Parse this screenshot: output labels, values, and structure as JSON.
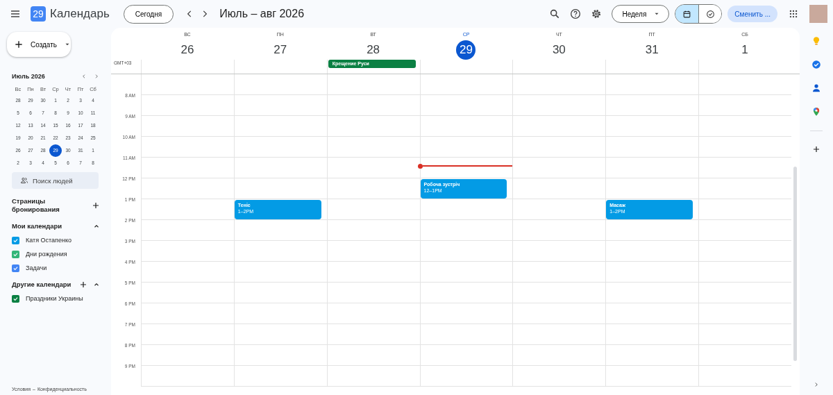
{
  "topbar": {
    "logo_text": "29",
    "app_name": "Календарь",
    "today_button": "Сегодня",
    "date_range": "Июль – авг 2026",
    "view_dropdown": "Неделя",
    "view_toggle": [
      {
        "kind": "calendar",
        "selected": true
      },
      {
        "kind": "tasks",
        "selected": false
      }
    ],
    "switch_button": "Сменить ..."
  },
  "sidebar": {
    "create_button": "Создать",
    "mini_calendar": {
      "title": "Июль 2026",
      "weekdays": [
        "Вс",
        "Пн",
        "Вт",
        "Ср",
        "Чт",
        "Пт",
        "Сб"
      ],
      "weeks": [
        [
          {
            "day": "28",
            "selected": false
          },
          {
            "day": "29",
            "selected": false
          },
          {
            "day": "30",
            "selected": false
          },
          {
            "day": "1",
            "selected": false
          },
          {
            "day": "2",
            "selected": false
          },
          {
            "day": "3",
            "selected": false
          },
          {
            "day": "4",
            "selected": false
          }
        ],
        [
          {
            "day": "5",
            "selected": false
          },
          {
            "day": "6",
            "selected": false
          },
          {
            "day": "7",
            "selected": false
          },
          {
            "day": "8",
            "selected": false
          },
          {
            "day": "9",
            "selected": false
          },
          {
            "day": "10",
            "selected": false
          },
          {
            "day": "11",
            "selected": false
          }
        ],
        [
          {
            "day": "12",
            "selected": false
          },
          {
            "day": "13",
            "selected": false
          },
          {
            "day": "14",
            "selected": false
          },
          {
            "day": "15",
            "selected": false
          },
          {
            "day": "16",
            "selected": false
          },
          {
            "day": "17",
            "selected": false
          },
          {
            "day": "18",
            "selected": false
          }
        ],
        [
          {
            "day": "19",
            "selected": false
          },
          {
            "day": "20",
            "selected": false
          },
          {
            "day": "21",
            "selected": false
          },
          {
            "day": "22",
            "selected": false
          },
          {
            "day": "23",
            "selected": false
          },
          {
            "day": "24",
            "selected": false
          },
          {
            "day": "25",
            "selected": false
          }
        ],
        [
          {
            "day": "26",
            "selected": false
          },
          {
            "day": "27",
            "selected": false
          },
          {
            "day": "28",
            "selected": false
          },
          {
            "day": "29",
            "selected": true
          },
          {
            "day": "30",
            "selected": false
          },
          {
            "day": "31",
            "selected": false
          },
          {
            "day": "1",
            "selected": false
          }
        ],
        [
          {
            "day": "2",
            "selected": false
          },
          {
            "day": "3",
            "selected": false
          },
          {
            "day": "4",
            "selected": false
          },
          {
            "day": "5",
            "selected": false
          },
          {
            "day": "6",
            "selected": false
          },
          {
            "day": "7",
            "selected": false
          },
          {
            "day": "8",
            "selected": false
          }
        ]
      ]
    },
    "people_search": {
      "placeholder": "Поиск людей"
    },
    "booking_pages": "Страницы бронирования",
    "my_calendars": {
      "title": "Мои календари",
      "expanded": true,
      "items": [
        {
          "name": "Катя Остапенко",
          "checked": true,
          "color": "#039be5"
        },
        {
          "name": "Дни рождения",
          "checked": true,
          "color": "#33b679"
        },
        {
          "name": "Задачи",
          "checked": true,
          "color": "#4285f4"
        }
      ]
    },
    "other_calendars": {
      "title": "Другие календари",
      "expanded": true,
      "items": [
        {
          "name": "Праздники Украины",
          "checked": true,
          "color": "#0b8043"
        }
      ]
    },
    "footer": {
      "terms": "Условия",
      "separator": "–",
      "privacy": "Конфиденциальность"
    }
  },
  "calendar": {
    "timezone": "GMT+03",
    "days": [
      {
        "weekday": "ВС",
        "date": "26",
        "selected": false
      },
      {
        "weekday": "ПН",
        "date": "27",
        "selected": false
      },
      {
        "weekday": "ВТ",
        "date": "28",
        "selected": false,
        "all_day": {
          "title": "Крещение Руси",
          "color": "#0b8043"
        }
      },
      {
        "weekday": "СР",
        "date": "29",
        "selected": true
      },
      {
        "weekday": "ЧТ",
        "date": "30",
        "selected": false
      },
      {
        "weekday": "ПТ",
        "date": "31",
        "selected": false
      },
      {
        "weekday": "СБ",
        "date": "1",
        "selected": false
      }
    ],
    "hours": [
      {
        "label": "8 AM"
      },
      {
        "label": "9 AM"
      },
      {
        "label": "10 AM"
      },
      {
        "label": "11 AM",
        "cells": [
          {},
          {},
          {},
          {
            "now_line": true
          },
          {},
          {},
          {}
        ]
      },
      {
        "label": "12 PM",
        "cells": [
          {},
          {},
          {},
          {
            "event": {
              "title": "Робоча зустріч",
              "time": "12–1PM",
              "color": "#039be5"
            }
          },
          {},
          {},
          {}
        ]
      },
      {
        "label": "1 PM",
        "cells": [
          {},
          {
            "event": {
              "title": "Теніс",
              "time": "1–2PM",
              "color": "#039be5"
            }
          },
          {},
          {},
          {},
          {
            "event": {
              "title": "Масаж",
              "time": "1–2PM",
              "color": "#039be5"
            }
          },
          {}
        ]
      },
      {
        "label": "2 PM"
      },
      {
        "label": "3 PM"
      },
      {
        "label": "4 PM"
      },
      {
        "label": "5 PM"
      },
      {
        "label": "6 PM"
      },
      {
        "label": "7 PM"
      },
      {
        "label": "8 PM"
      },
      {
        "label": "9 PM"
      }
    ]
  }
}
